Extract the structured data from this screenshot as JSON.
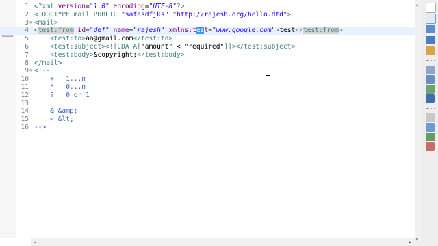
{
  "editor": {
    "current_line": 4,
    "lines": [
      {
        "num": "1",
        "fold": "",
        "tokens": [
          [
            "tag",
            "<?xml "
          ],
          [
            "attr",
            "version"
          ],
          [
            "txt",
            "="
          ],
          [
            "val",
            "\"1.0\""
          ],
          [
            "txt",
            " "
          ],
          [
            "attr",
            "encoding"
          ],
          [
            "txt",
            "="
          ],
          [
            "val",
            "\"UTF-8\""
          ],
          [
            "tag",
            "?>"
          ]
        ]
      },
      {
        "num": "2",
        "fold": "",
        "tokens": [
          [
            "tag",
            "<!DOCTYPE mail PUBLIC "
          ],
          [
            "dval",
            "\"safasdfjks\""
          ],
          [
            "txt",
            " "
          ],
          [
            "dval",
            "\"http://rajesh.org/hello.dtd\""
          ],
          [
            "tag",
            ">"
          ]
        ]
      },
      {
        "num": "3",
        "fold": "⊖",
        "tokens": [
          [
            "tag",
            "<mail>"
          ]
        ]
      },
      {
        "num": "4",
        "fold": "",
        "tokens": [
          [
            "tag",
            "<"
          ],
          [
            "hltag",
            "test:from"
          ],
          [
            "txt",
            " "
          ],
          [
            "attr",
            "id"
          ],
          [
            "txt",
            "="
          ],
          [
            "val",
            "\"def\""
          ],
          [
            "txt",
            " "
          ],
          [
            "attr",
            "name"
          ],
          [
            "txt",
            "="
          ],
          [
            "val",
            "\"rajesh\""
          ],
          [
            "txt",
            " "
          ],
          [
            "attr",
            "xmlns:t"
          ],
          [
            "sel",
            "es"
          ],
          [
            "attr",
            "t"
          ],
          [
            "txt",
            "="
          ],
          [
            "val",
            "\"www.google.com\""
          ],
          [
            "tag",
            ">"
          ],
          [
            "txt",
            "test"
          ],
          [
            "tag",
            "</"
          ],
          [
            "hltag",
            "test:from"
          ],
          [
            "tag",
            ">"
          ]
        ]
      },
      {
        "num": "5",
        "fold": "",
        "tokens": [
          [
            "txt",
            "    "
          ],
          [
            "tag",
            "<test:to>"
          ],
          [
            "txt",
            "aa@gmail.com"
          ],
          [
            "tag",
            "</test:to>"
          ]
        ]
      },
      {
        "num": "6",
        "fold": "",
        "tokens": [
          [
            "txt",
            "    "
          ],
          [
            "tag",
            "<test:subject><![CDATA["
          ],
          [
            "txt",
            "\"amount\" < \"required\""
          ],
          [
            "tag",
            "]]></test:subject>"
          ]
        ]
      },
      {
        "num": "7",
        "fold": "",
        "tokens": [
          [
            "txt",
            "    "
          ],
          [
            "tag",
            "<test:body>"
          ],
          [
            "txt",
            "&copyright;"
          ],
          [
            "tag",
            "</test:body>"
          ]
        ]
      },
      {
        "num": "8",
        "fold": "",
        "tokens": [
          [
            "tag",
            "</mail>"
          ]
        ]
      },
      {
        "num": "9",
        "fold": "⊖",
        "tokens": [
          [
            "cmt",
            "<!--"
          ]
        ]
      },
      {
        "num": "10",
        "fold": "",
        "tokens": [
          [
            "cmt",
            "    +   1...n"
          ]
        ]
      },
      {
        "num": "11",
        "fold": "",
        "tokens": [
          [
            "cmt",
            "    *   0...n"
          ]
        ]
      },
      {
        "num": "12",
        "fold": "",
        "tokens": [
          [
            "cmt",
            "    ?   0 or 1"
          ]
        ]
      },
      {
        "num": "13",
        "fold": "",
        "tokens": [
          [
            "cmt",
            ""
          ]
        ]
      },
      {
        "num": "14",
        "fold": "",
        "tokens": [
          [
            "cmt",
            "    & &amp;"
          ]
        ]
      },
      {
        "num": "15",
        "fold": "",
        "tokens": [
          [
            "cmt",
            "    < &lt;"
          ]
        ]
      },
      {
        "num": "16",
        "fold": "",
        "tokens": [
          [
            "cmt",
            "-->"
          ]
        ]
      }
    ]
  },
  "scrollbar": {
    "left_arrow": "◂",
    "right_arrow": "▸",
    "up_arrow": "▴",
    "down_arrow": "▾"
  },
  "toolbar_icons": [
    "restore-icon",
    "minimize-icon",
    "outline-icon",
    "project-explorer-icon",
    "problems-icon",
    "navigator-icon",
    "tasks-icon",
    "properties-icon",
    "console-icon",
    "hierarchy-icon",
    "search-icon",
    "bookmarks-icon",
    "palette-icon"
  ],
  "colors": {
    "current_line": "#e8f2fe",
    "tag": "#3f7f7f",
    "attr": "#7f007f",
    "value": "#2a00ff",
    "comment": "#3f5fbf"
  }
}
